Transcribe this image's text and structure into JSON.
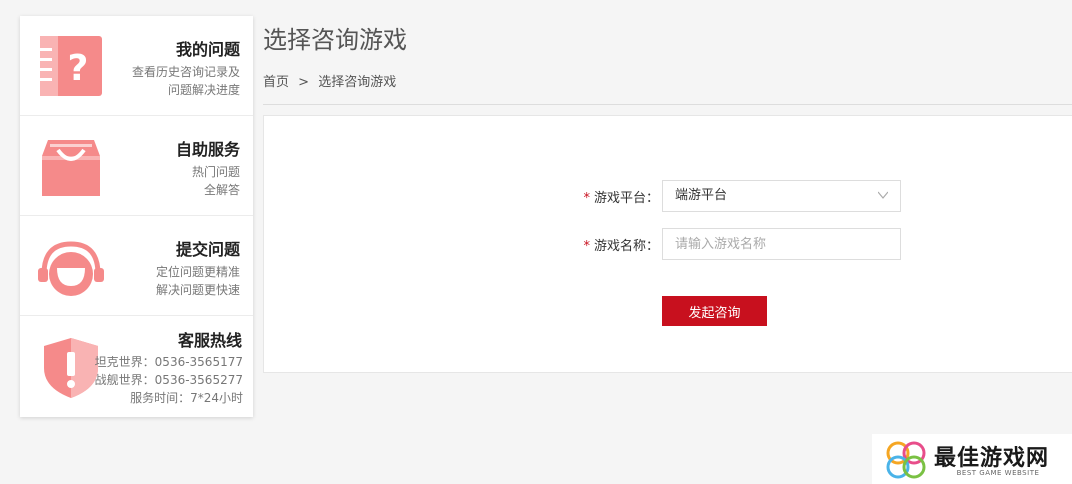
{
  "sidebar": {
    "items": [
      {
        "title": "我的问题",
        "desc1": "查看历史咨询记录及",
        "desc2": "问题解决进度",
        "icon": "question-book-icon"
      },
      {
        "title": "自助服务",
        "desc1": "热门问题",
        "desc2": "全解答",
        "icon": "inbox-tray-icon"
      },
      {
        "title": "提交问题",
        "desc1": "定位问题更精准",
        "desc2": "解决问题更快速",
        "icon": "headset-icon"
      },
      {
        "title": "客服热线",
        "line1": "坦克世界：0536-3565177",
        "line2": "战舰世界：0536-3565277",
        "line3": "服务时间：7*24小时",
        "icon": "shield-alert-icon"
      }
    ]
  },
  "main": {
    "title": "选择咨询游戏",
    "breadcrumb": {
      "home": "首页",
      "separator": ">",
      "current": "选择咨询游戏"
    }
  },
  "form": {
    "platform_label": "游戏平台：",
    "platform_value": "端游平台",
    "name_label": "游戏名称：",
    "name_placeholder": "请输入游戏名称",
    "required_mark": "*",
    "submit_label": "发起咨询"
  },
  "watermark": {
    "title": "最佳游戏网",
    "subtitle": "BEST GAME WEBSITE"
  },
  "colors": {
    "accent_red": "#c8101e",
    "icon_pink": "#f58a8a",
    "background": "#f5f5f5"
  }
}
